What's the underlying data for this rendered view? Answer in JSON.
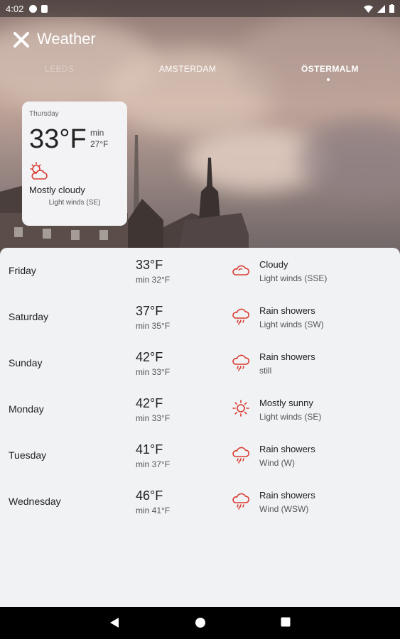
{
  "status_bar": {
    "time": "4:02"
  },
  "header": {
    "title": "Weather"
  },
  "city_tabs": [
    {
      "label": "LEEDS",
      "state": "faded"
    },
    {
      "label": "AMSTERDAM",
      "state": "normal"
    },
    {
      "label": "ÖSTERMALM",
      "state": "active"
    }
  ],
  "today": {
    "day": "Thursday",
    "temp": "33°F",
    "min_label": "min",
    "min": "27°F",
    "icon": "partly-cloudy-icon",
    "condition": "Mostly cloudy",
    "wind": "Light winds (SE)"
  },
  "forecast": [
    {
      "day": "Friday",
      "hi": "33°F",
      "lo": "min 32°F",
      "icon": "cloudy-icon",
      "condition": "Cloudy",
      "wind": "Light winds (SSE)"
    },
    {
      "day": "Saturday",
      "hi": "37°F",
      "lo": "min 35°F",
      "icon": "rain-icon",
      "condition": "Rain showers",
      "wind": "Light winds (SW)"
    },
    {
      "day": "Sunday",
      "hi": "42°F",
      "lo": "min 33°F",
      "icon": "rain-icon",
      "condition": "Rain showers",
      "wind": "still"
    },
    {
      "day": "Monday",
      "hi": "42°F",
      "lo": "min 33°F",
      "icon": "sun-icon",
      "condition": "Mostly sunny",
      "wind": "Light winds (SE)"
    },
    {
      "day": "Tuesday",
      "hi": "41°F",
      "lo": "min 37°F",
      "icon": "rain-icon",
      "condition": "Rain showers",
      "wind": "Wind (W)"
    },
    {
      "day": "Wednesday",
      "hi": "46°F",
      "lo": "min 41°F",
      "icon": "rain-icon",
      "condition": "Rain showers",
      "wind": "Wind (WSW)"
    }
  ],
  "colors": {
    "accent": "#d93a30",
    "card": "#f3f3f5",
    "list_bg": "#f1f2f4"
  }
}
